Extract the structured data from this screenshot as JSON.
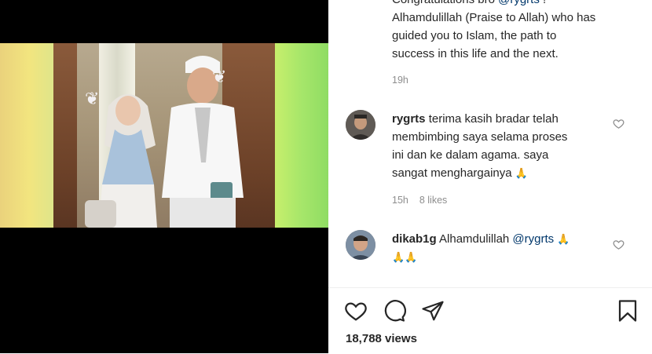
{
  "top_comment": {
    "line1_prefix": "Congratulations bro ",
    "line1_mention": "@rygrts",
    "line1_suffix": " !",
    "line2": "Alhamdulillah (Praise to Allah) who has",
    "line3": "guided you to Islam, the path to",
    "line4": "success in this life and the next.",
    "time": "19h"
  },
  "comments": [
    {
      "username": "rygrts",
      "line1": "terima kasih bradar telah",
      "line2": "membimbing saya selama proses",
      "line3": "ini dan ke dalam agama. saya",
      "line4": "sangat menghargainya",
      "emoji": "🙏",
      "time": "15h",
      "likes": "8 likes"
    },
    {
      "username": "dikab1g",
      "text": "Alhamdulillah ",
      "mention": "@rygrts",
      "emoji_inline": "🙏",
      "emoji_line2": "🙏🙏"
    }
  ],
  "actions": {
    "like_icon": "heart-icon",
    "comment_icon": "comment-icon",
    "share_icon": "share-icon",
    "save_icon": "bookmark-icon"
  },
  "views": "18,788 views",
  "colors": {
    "text": "#262626",
    "muted": "#8e8e8e",
    "mention": "#00376b",
    "media_bg": "#000000"
  }
}
